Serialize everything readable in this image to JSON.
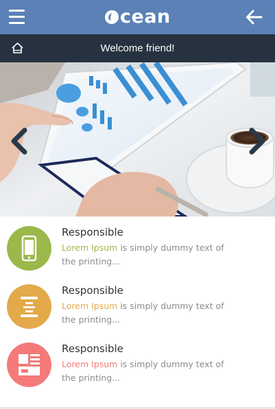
{
  "header": {
    "brand": "cean",
    "menu_icon": "hamburger-menu-icon",
    "back_icon": "arrow-left-icon",
    "color": "#5b81b6"
  },
  "welcome_bar": {
    "text": "Welcome friend!",
    "home_icon": "home-icon",
    "color": "#26323f"
  },
  "slider": {
    "prev_icon": "chevron-left-icon",
    "next_icon": "chevron-right-icon"
  },
  "features": [
    {
      "title": "Responsible",
      "link": "Lorem Ipsum",
      "line1": " is simply dummy text of",
      "line2": "the printing...",
      "icon": "smartphone-icon",
      "color": "#9bb84b"
    },
    {
      "title": "Responsible",
      "link": "Lorem Ipsum",
      "line1": " is simply dummy text of",
      "line2": "the printing...",
      "icon": "align-center-icon",
      "color": "#e3a94a"
    },
    {
      "title": "Responsible",
      "link": "Lorem Ipsum",
      "line1": " is simply dummy text of",
      "line2": "the printing...",
      "icon": "layout-icon",
      "color": "#f47a79"
    }
  ]
}
